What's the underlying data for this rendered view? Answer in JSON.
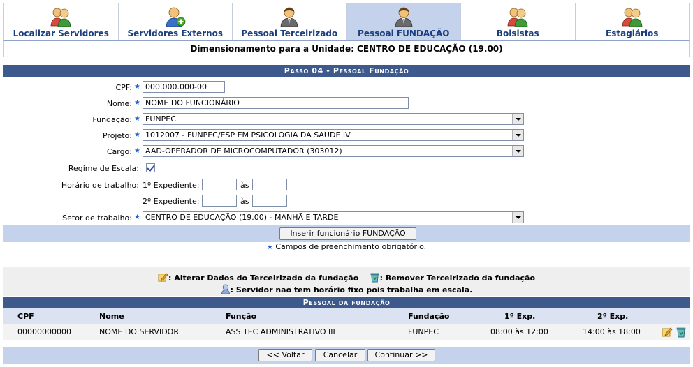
{
  "tabs": [
    {
      "label": "Localizar Servidores",
      "icon": "two-users-icon"
    },
    {
      "label": "Servidores Externos",
      "icon": "user-add-icon"
    },
    {
      "label": "Pessoal Terceirizado",
      "icon": "user-suit-icon"
    },
    {
      "label": "Pessoal FUNDAÇÃO",
      "icon": "user-suit-icon",
      "active": true
    },
    {
      "label": "Bolsistas",
      "icon": "two-users-icon"
    },
    {
      "label": "Estagiários",
      "icon": "two-users-icon"
    }
  ],
  "unit_title": "Dimensionamento para a Unidade: CENTRO DE EDUCAÇÃO (19.00)",
  "form": {
    "caption": "Passo 04 - Pessoal Fundação",
    "cpf": {
      "label": "CPF:",
      "value": "000.000.000-00"
    },
    "nome": {
      "label": "Nome:",
      "value": "NOME DO FUNCIONÁRIO"
    },
    "fundacao": {
      "label": "Fundação:",
      "value": "FUNPEC"
    },
    "projeto": {
      "label": "Projeto:",
      "value": "1012007 - FUNPEC/ESP EM PSICOLOGIA DA SAUDE IV"
    },
    "cargo": {
      "label": "Cargo:",
      "value": "AAD-OPERADOR DE MICROCOMPUTADOR (303012)"
    },
    "regime": {
      "label": "Regime de Escala:",
      "checked": true
    },
    "horario": {
      "label": "Horário de trabalho:",
      "exp1_label": "1º Expediente:",
      "exp2_label": "2º Expediente:",
      "as_label": "às",
      "exp1_start": "",
      "exp1_end": "",
      "exp2_start": "",
      "exp2_end": ""
    },
    "setor": {
      "label": "Setor de trabalho:",
      "value": "CENTRO DE EDUCAÇÃO (19.00) - MANHÃ E TARDE"
    },
    "insert_button": "Inserir funcionário FUNDAÇÃO",
    "required_note": "Campos de preenchimento obrigatório."
  },
  "legend": {
    "alter": ": Alterar Dados do Terceirizado da fundação",
    "remove": ": Remover Terceirizado da fundação",
    "escala": ": Servidor não tem horário fixo pois trabalha em escala."
  },
  "table": {
    "caption": "Pessoal da fundação",
    "headers": [
      "CPF",
      "Nome",
      "Função",
      "Fundação",
      "1º Exp.",
      "2º Exp."
    ],
    "rows": [
      [
        "00000000000",
        "NOME DO SERVIDOR",
        "ASS TEC ADMINISTRATIVO III",
        "FUNPEC",
        "08:00 às 12:00",
        "14:00 às 18:00"
      ]
    ]
  },
  "nav": {
    "back": "<< Voltar",
    "cancel": "Cancelar",
    "continue": "Continuar >>"
  },
  "colors": {
    "caption_bg": "#3e5a8c",
    "active_tab": "#c4d2eb",
    "tab_text": "#1b3f7c",
    "required_star": "#2a5bd7"
  }
}
